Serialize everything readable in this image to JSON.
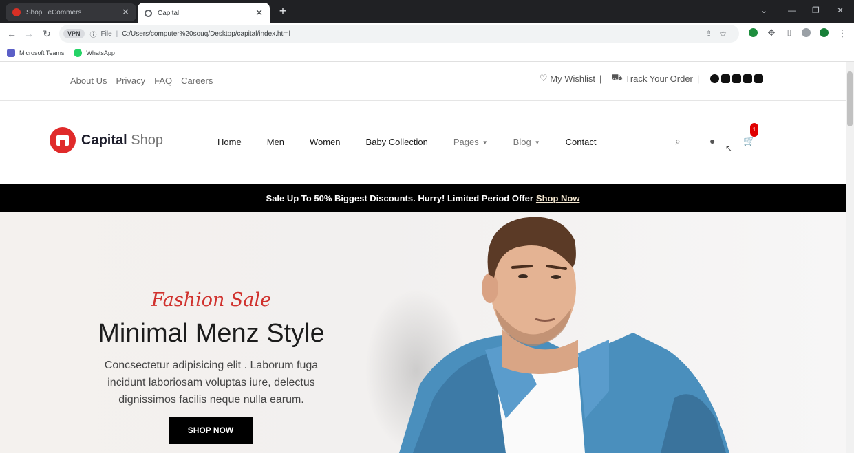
{
  "browser": {
    "tabs": [
      {
        "title": "Shop | eCommers",
        "active": false
      },
      {
        "title": "Capital",
        "active": true
      }
    ],
    "address": {
      "vpn_label": "VPN",
      "scheme_label": "File",
      "url": "C:/Users/computer%20souq/Desktop/capital/index.html"
    },
    "bookmarks": [
      "Microsoft Teams",
      "WhatsApp"
    ]
  },
  "site": {
    "topbar": {
      "links": [
        "About Us",
        "Privacy",
        "FAQ",
        "Careers"
      ],
      "wishlist": "My Wishlist",
      "track_order": "Track Your Order",
      "separator": "|"
    },
    "logo": {
      "bold": "Capital",
      "light": "Shop"
    },
    "menu": {
      "home": "Home",
      "men": "Men",
      "women": "Women",
      "baby": "Baby Collection",
      "pages": "Pages",
      "blog": "Blog",
      "contact": "Contact"
    },
    "cart_count": "1",
    "promo": {
      "text": "Sale Up To 50% Biggest Discounts. Hurry! Limited Period Offer",
      "link": "Shop Now"
    },
    "hero": {
      "eyebrow": "Fashion Sale",
      "title": "Minimal Menz Style",
      "description_lines": [
        "Concsectetur adipisicing elit . Laborum fuga",
        "incidunt laboriosam voluptas iure, delectus",
        "dignissimos facilis neque nulla earum."
      ],
      "cta": "SHOP NOW"
    }
  },
  "colors": {
    "brand_red": "#e02a2a",
    "promo_bg": "#000000",
    "eyebrow": "#d0312d",
    "badge": "#e00000"
  },
  "icons": [
    "back-arrow-icon",
    "forward-arrow-icon",
    "reload-icon",
    "info-icon",
    "share-icon",
    "star-icon",
    "heart-icon",
    "truck-icon",
    "facebook-icon",
    "instagram-icon",
    "twitter-icon",
    "linkedin-icon",
    "youtube-icon",
    "search-icon",
    "user-icon",
    "cart-icon"
  ]
}
